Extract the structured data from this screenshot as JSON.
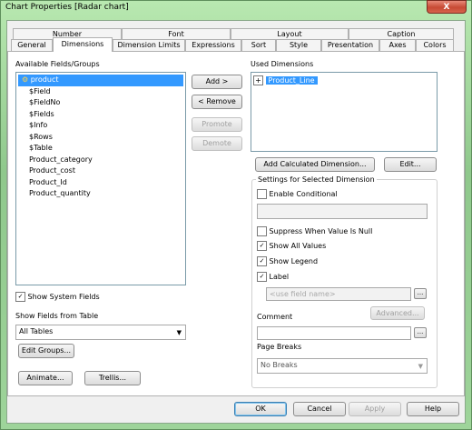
{
  "window": {
    "title": "Chart Properties [Radar chart]",
    "close": "X"
  },
  "tabs_top": [
    "Number",
    "Font",
    "Layout",
    "Caption"
  ],
  "tabs_bottom": [
    "General",
    "Dimensions",
    "Dimension Limits",
    "Expressions",
    "Sort",
    "Style",
    "Presentation",
    "Axes",
    "Colors"
  ],
  "available": {
    "label": "Available Fields/Groups",
    "items": [
      "product",
      "$Field",
      "$FieldNo",
      "$Fields",
      "$Info",
      "$Rows",
      "$Table",
      "Product_category",
      "Product_cost",
      "Product_Id",
      "Product_quantity"
    ]
  },
  "mid_buttons": {
    "add": "Add >",
    "remove": "< Remove",
    "promote": "Promote",
    "demote": "Demote"
  },
  "used": {
    "label": "Used Dimensions",
    "items": [
      "Product_Line"
    ],
    "expand": "+"
  },
  "calc_button": "Add Calculated Dimension...",
  "edit_button": "Edit...",
  "settings": {
    "legend": "Settings for Selected Dimension",
    "enable_conditional": "Enable Conditional",
    "suppress_null": "Suppress When Value Is Null",
    "show_all_values": "Show All Values",
    "show_legend": "Show Legend",
    "label": "Label",
    "label_placeholder": "<use field name>",
    "advanced": "Advanced...",
    "comment": "Comment",
    "page_breaks": "Page Breaks",
    "page_breaks_value": "No Breaks",
    "browse": "..."
  },
  "left_lower": {
    "show_system": "Show System Fields",
    "show_from_table": "Show Fields from Table",
    "table_value": "All Tables",
    "edit_groups": "Edit Groups...",
    "animate": "Animate...",
    "trellis": "Trellis..."
  },
  "footer": {
    "ok": "OK",
    "cancel": "Cancel",
    "apply": "Apply",
    "help": "Help"
  },
  "checkmark": "✓",
  "dropdown_arrow": "▼"
}
